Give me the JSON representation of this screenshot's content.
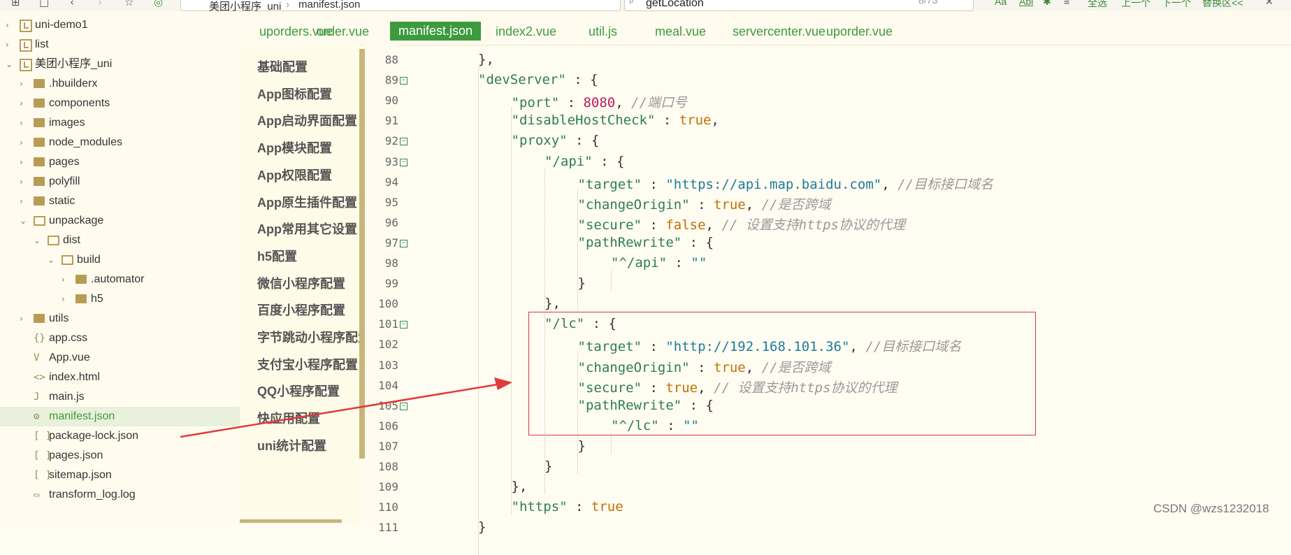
{
  "toolbar": {
    "path": [
      "美团小程序_uni",
      "manifest.json"
    ],
    "search_value": "getLocation",
    "find_info": "8/73",
    "match_case": "Aa",
    "whole_word": "Abl",
    "select_all": "全选",
    "prev": "上一个",
    "next": "下一个",
    "replace": "替换区<<"
  },
  "file_tree": [
    {
      "label": "uni-demo1",
      "type": "project",
      "depth": 0,
      "chevron": "right"
    },
    {
      "label": "list",
      "type": "project",
      "depth": 0,
      "chevron": "right"
    },
    {
      "label": "美团小程序_uni",
      "type": "project",
      "depth": 0,
      "chevron": "down"
    },
    {
      "label": ".hbuilderx",
      "type": "folder",
      "depth": 1,
      "chevron": "right"
    },
    {
      "label": "components",
      "type": "folder",
      "depth": 1,
      "chevron": "right"
    },
    {
      "label": "images",
      "type": "folder",
      "depth": 1,
      "chevron": "right"
    },
    {
      "label": "node_modules",
      "type": "folder",
      "depth": 1,
      "chevron": "right"
    },
    {
      "label": "pages",
      "type": "folder",
      "depth": 1,
      "chevron": "right"
    },
    {
      "label": "polyfill",
      "type": "folder",
      "depth": 1,
      "chevron": "right"
    },
    {
      "label": "static",
      "type": "folder",
      "depth": 1,
      "chevron": "right"
    },
    {
      "label": "unpackage",
      "type": "folder-open",
      "depth": 1,
      "chevron": "down"
    },
    {
      "label": "dist",
      "type": "folder-open",
      "depth": 2,
      "chevron": "down"
    },
    {
      "label": "build",
      "type": "folder-open",
      "depth": 3,
      "chevron": "down"
    },
    {
      "label": ".automator",
      "type": "folder",
      "depth": 4,
      "chevron": "right"
    },
    {
      "label": "h5",
      "type": "folder",
      "depth": 4,
      "chevron": "right"
    },
    {
      "label": "utils",
      "type": "folder",
      "depth": 1,
      "chevron": "right"
    },
    {
      "label": "app.css",
      "type": "file",
      "icon": "{}",
      "depth": 1
    },
    {
      "label": "App.vue",
      "type": "file",
      "icon": "V",
      "depth": 1
    },
    {
      "label": "index.html",
      "type": "file",
      "icon": "<>",
      "depth": 1
    },
    {
      "label": "main.js",
      "type": "file",
      "icon": "J",
      "depth": 1
    },
    {
      "label": "manifest.json",
      "type": "file",
      "icon": "⚙",
      "depth": 1,
      "selected": true
    },
    {
      "label": "package-lock.json",
      "type": "file",
      "icon": "[ ]",
      "depth": 1
    },
    {
      "label": "pages.json",
      "type": "file",
      "icon": "[ ]",
      "depth": 1
    },
    {
      "label": "sitemap.json",
      "type": "file",
      "icon": "[ ]",
      "depth": 1
    },
    {
      "label": "transform_log.log",
      "type": "file",
      "icon": "▭",
      "depth": 1
    }
  ],
  "tabs": [
    {
      "label": "uporders.vue",
      "active": false
    },
    {
      "label": "order.vue",
      "active": false
    },
    {
      "label": "manifest.json",
      "active": true
    },
    {
      "label": "index2.vue",
      "active": false
    },
    {
      "label": "util.js",
      "active": false
    },
    {
      "label": "meal.vue",
      "active": false
    },
    {
      "label": "servercenter.vue",
      "active": false
    },
    {
      "label": "uporder.vue",
      "active": false
    }
  ],
  "config_nav": [
    "基础配置",
    "App图标配置",
    "App启动界面配置",
    "App模块配置",
    "App权限配置",
    "App原生插件配置",
    "App常用其它设置",
    "h5配置",
    "微信小程序配置",
    "百度小程序配置",
    "字节跳动小程序配置",
    "支付宝小程序配置",
    "QQ小程序配置",
    "快应用配置",
    "uni统计配置"
  ],
  "code_lines": [
    {
      "num": "88",
      "indent": 2,
      "fold": false,
      "tokens": [
        [
          "p",
          "},"
        ]
      ]
    },
    {
      "num": "89",
      "indent": 2,
      "fold": true,
      "tokens": [
        [
          "k",
          "\"devServer\""
        ],
        [
          "p",
          " : {"
        ]
      ]
    },
    {
      "num": "90",
      "indent": 3,
      "fold": false,
      "tokens": [
        [
          "k",
          "\"port\""
        ],
        [
          "p",
          " : "
        ],
        [
          "n",
          "8080"
        ],
        [
          "p",
          ", "
        ],
        [
          "c",
          "//端口号"
        ]
      ]
    },
    {
      "num": "91",
      "indent": 3,
      "fold": false,
      "tokens": [
        [
          "k",
          "\"disableHostCheck\""
        ],
        [
          "p",
          " : "
        ],
        [
          "b",
          "true"
        ],
        [
          "p",
          ","
        ]
      ]
    },
    {
      "num": "92",
      "indent": 3,
      "fold": true,
      "tokens": [
        [
          "k",
          "\"proxy\""
        ],
        [
          "p",
          " : {"
        ]
      ]
    },
    {
      "num": "93",
      "indent": 4,
      "fold": true,
      "tokens": [
        [
          "k",
          "\"/api\""
        ],
        [
          "p",
          " : {"
        ]
      ]
    },
    {
      "num": "94",
      "indent": 5,
      "fold": false,
      "tokens": [
        [
          "k",
          "\"target\""
        ],
        [
          "p",
          " : "
        ],
        [
          "s",
          "\"https://api.map.baidu.com\""
        ],
        [
          "p",
          ", "
        ],
        [
          "c",
          "//目标接口域名"
        ]
      ]
    },
    {
      "num": "95",
      "indent": 5,
      "fold": false,
      "tokens": [
        [
          "k",
          "\"changeOrigin\""
        ],
        [
          "p",
          " : "
        ],
        [
          "b",
          "true"
        ],
        [
          "p",
          ", "
        ],
        [
          "c",
          "//是否跨域"
        ]
      ]
    },
    {
      "num": "96",
      "indent": 5,
      "fold": false,
      "tokens": [
        [
          "k",
          "\"secure\""
        ],
        [
          "p",
          " : "
        ],
        [
          "b",
          "false"
        ],
        [
          "p",
          ", "
        ],
        [
          "c",
          "// 设置支持https协议的代理"
        ]
      ]
    },
    {
      "num": "97",
      "indent": 5,
      "fold": true,
      "tokens": [
        [
          "k",
          "\"pathRewrite\""
        ],
        [
          "p",
          " : {"
        ]
      ]
    },
    {
      "num": "98",
      "indent": 6,
      "fold": false,
      "tokens": [
        [
          "k",
          "\"^/api\""
        ],
        [
          "p",
          " : "
        ],
        [
          "s",
          "\"\""
        ]
      ]
    },
    {
      "num": "99",
      "indent": 5,
      "fold": false,
      "tokens": [
        [
          "p",
          "}"
        ]
      ]
    },
    {
      "num": "100",
      "indent": 4,
      "fold": false,
      "tokens": [
        [
          "p",
          "},"
        ]
      ]
    },
    {
      "num": "101",
      "indent": 4,
      "fold": true,
      "tokens": [
        [
          "k",
          "\"/lc\""
        ],
        [
          "p",
          " : {"
        ]
      ]
    },
    {
      "num": "102",
      "indent": 5,
      "fold": false,
      "tokens": [
        [
          "k",
          "\"target\""
        ],
        [
          "p",
          " : "
        ],
        [
          "s",
          "\"http://192.168.101.36\""
        ],
        [
          "p",
          ", "
        ],
        [
          "c",
          "//目标接口域名"
        ]
      ]
    },
    {
      "num": "103",
      "indent": 5,
      "fold": false,
      "tokens": [
        [
          "k",
          "\"changeOrigin\""
        ],
        [
          "p",
          " : "
        ],
        [
          "b",
          "true"
        ],
        [
          "p",
          ", "
        ],
        [
          "c",
          "//是否跨域"
        ]
      ]
    },
    {
      "num": "104",
      "indent": 5,
      "fold": false,
      "tokens": [
        [
          "k",
          "\"secure\""
        ],
        [
          "p",
          " : "
        ],
        [
          "b",
          "true"
        ],
        [
          "p",
          ", "
        ],
        [
          "c",
          "// 设置支持https协议的代理"
        ]
      ]
    },
    {
      "num": "105",
      "indent": 5,
      "fold": true,
      "tokens": [
        [
          "k",
          "\"pathRewrite\""
        ],
        [
          "p",
          " : {"
        ]
      ]
    },
    {
      "num": "106",
      "indent": 6,
      "fold": false,
      "tokens": [
        [
          "k",
          "\"^/lc\""
        ],
        [
          "p",
          " : "
        ],
        [
          "s",
          "\"\""
        ]
      ]
    },
    {
      "num": "107",
      "indent": 5,
      "fold": false,
      "tokens": [
        [
          "p",
          "}"
        ]
      ]
    },
    {
      "num": "108",
      "indent": 4,
      "fold": false,
      "tokens": [
        [
          "p",
          "}"
        ]
      ]
    },
    {
      "num": "109",
      "indent": 3,
      "fold": false,
      "tokens": [
        [
          "p",
          "},"
        ]
      ]
    },
    {
      "num": "110",
      "indent": 3,
      "fold": false,
      "tokens": [
        [
          "k",
          "\"https\""
        ],
        [
          "p",
          " : "
        ],
        [
          "b",
          "true"
        ]
      ]
    },
    {
      "num": "111",
      "indent": 2,
      "fold": false,
      "tokens": [
        [
          "p",
          "}"
        ]
      ]
    }
  ],
  "watermark": "CSDN @wzs1232018",
  "colors": {
    "accent": "#3d9a3d",
    "annotation": "#d9363e",
    "background": "#fffdf2"
  }
}
